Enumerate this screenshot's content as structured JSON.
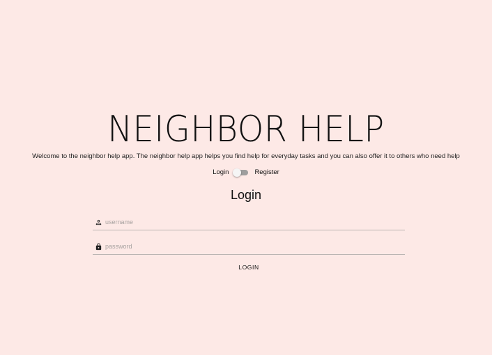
{
  "app": {
    "title": "NEIGHBOR HELP",
    "tagline": "Welcome to the neighbor help app. The neighbor help app helps you find help for everyday tasks and you can also offer it to others who need help"
  },
  "mode_switch": {
    "left_label": "Login",
    "right_label": "Register",
    "state": "off"
  },
  "form": {
    "heading": "Login",
    "username": {
      "icon": "person-icon",
      "placeholder": "username",
      "value": ""
    },
    "password": {
      "icon": "lock-icon",
      "placeholder": "password",
      "value": ""
    },
    "submit_label": "LOGIN"
  },
  "colors": {
    "background": "#fde9e6",
    "toggle_track": "#9e9e9e",
    "toggle_knob": "#f5f5f5",
    "underline": "#b9b3b1",
    "text": "#111111"
  }
}
